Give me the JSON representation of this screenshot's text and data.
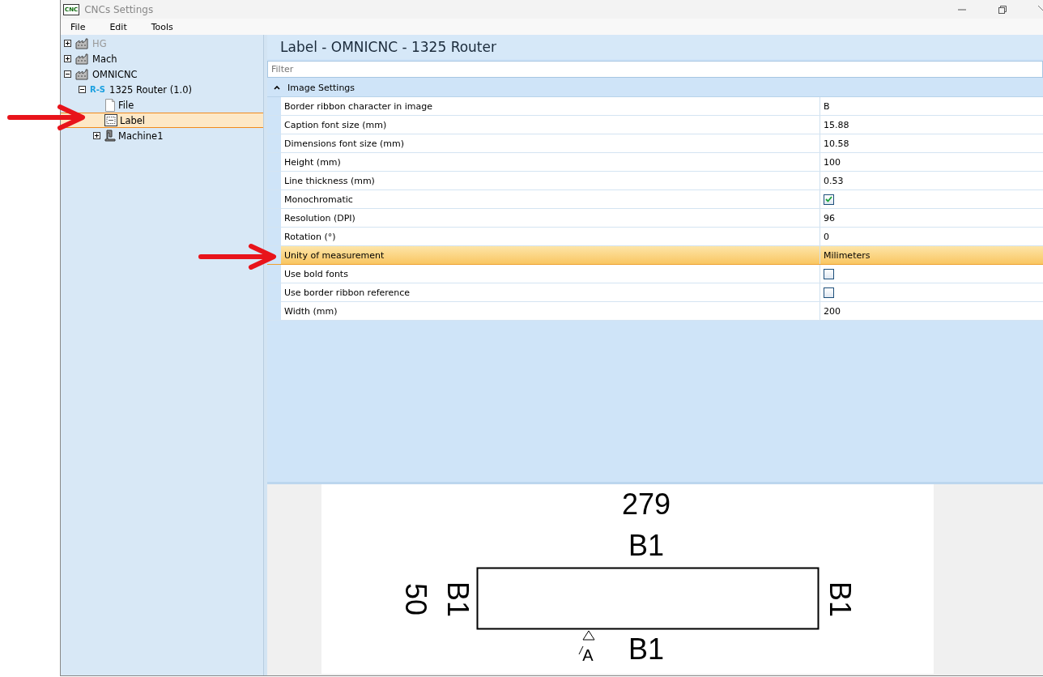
{
  "window": {
    "icon_text": "CNC",
    "title": "CNCs Settings"
  },
  "menu": [
    "File",
    "Edit",
    "Tools"
  ],
  "tree": [
    {
      "label": "HG",
      "kind": "factory",
      "expanded": false,
      "disabled": true,
      "selected": false
    },
    {
      "label": "Mach",
      "kind": "factory",
      "expanded": false,
      "disabled": false,
      "selected": false
    },
    {
      "label": "OMNICNC",
      "kind": "factory",
      "expanded": true,
      "disabled": false,
      "selected": false,
      "children": [
        {
          "label": "1325 Router (1.0)",
          "kind": "router",
          "badge": "R-S",
          "expanded": true,
          "disabled": false,
          "selected": false,
          "children": [
            {
              "label": "File",
              "kind": "file",
              "disabled": false,
              "selected": false
            },
            {
              "label": "Label",
              "kind": "label",
              "disabled": false,
              "selected": true
            },
            {
              "label": "Machine1",
              "kind": "machine",
              "expanded": false,
              "disabled": false,
              "selected": false
            }
          ]
        }
      ]
    }
  ],
  "panel": {
    "title": "Label - OMNICNC - 1325 Router",
    "filter": {
      "placeholder": "Filter"
    },
    "group": {
      "title": "Image Settings",
      "expanded": true
    },
    "properties": [
      {
        "name": "Border ribbon character in image",
        "kind": "text",
        "value": "B",
        "selected": false
      },
      {
        "name": "Caption font size (mm)",
        "kind": "text",
        "value": "15.88",
        "selected": false
      },
      {
        "name": "Dimensions font size (mm)",
        "kind": "text",
        "value": "10.58",
        "selected": false
      },
      {
        "name": "Height (mm)",
        "kind": "text",
        "value": "100",
        "selected": false
      },
      {
        "name": "Line thickness (mm)",
        "kind": "text",
        "value": "0.53",
        "selected": false
      },
      {
        "name": "Monochromatic",
        "kind": "checkbox",
        "checked": true,
        "selected": false
      },
      {
        "name": "Resolution (DPI)",
        "kind": "text",
        "value": "96",
        "selected": false
      },
      {
        "name": "Rotation (°)",
        "kind": "text",
        "value": "0",
        "selected": false
      },
      {
        "name": "Unity of measurement",
        "kind": "text",
        "value": "Milimeters",
        "selected": true
      },
      {
        "name": "Use bold fonts",
        "kind": "checkbox",
        "checked": false,
        "selected": false
      },
      {
        "name": "Use border ribbon reference",
        "kind": "checkbox",
        "checked": false,
        "selected": false
      },
      {
        "name": "Width (mm)",
        "kind": "text",
        "value": "200",
        "selected": false
      }
    ]
  },
  "preview": {
    "width_label": "279",
    "top": "B1",
    "height_label": "50",
    "left": "B1",
    "right": "B1",
    "bottom": "B1",
    "marker": "A"
  }
}
